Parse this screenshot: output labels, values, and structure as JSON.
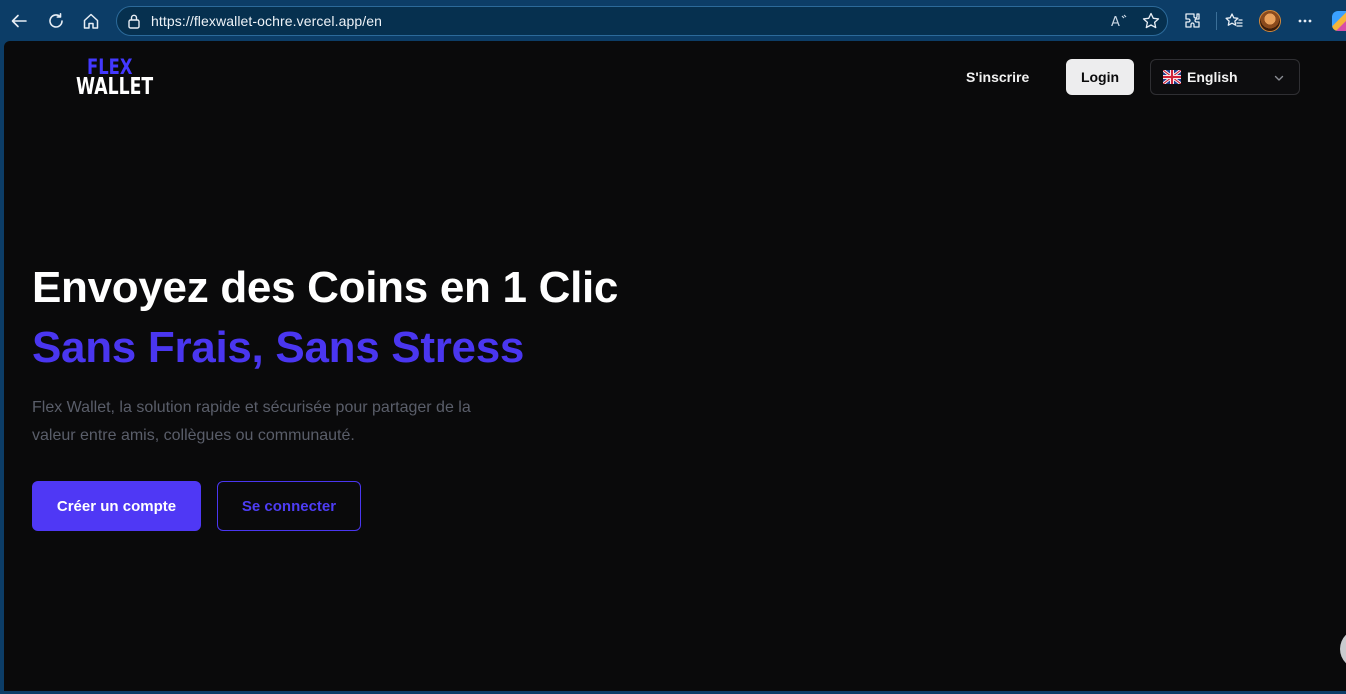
{
  "browser": {
    "url": "https://flexwallet-ochre.vercel.app/en",
    "icons": [
      "back-icon",
      "refresh-icon",
      "home-icon",
      "lock-icon",
      "read-aloud-icon",
      "favorite-star-icon",
      "extensions-icon",
      "favorites-icon",
      "profile-avatar",
      "more-icon",
      "copilot-icon"
    ]
  },
  "logo": {
    "top": "FLEX",
    "bottom": "WALLET"
  },
  "nav": {
    "signup_label": "S'inscrire",
    "login_label": "Login",
    "language": "English"
  },
  "hero": {
    "title": "Envoyez des Coins en 1 Clic",
    "subtitle": "Sans Frais, Sans Stress",
    "description_line1": "Flex Wallet, la solution rapide et sécurisée pour partager de la",
    "description_line2": "valeur entre amis, collègues ou communauté.",
    "primary_button": "Créer un compte",
    "secondary_button": "Se connecter"
  },
  "colors": {
    "accent": "#4f38f5",
    "background": "#0a0a0b",
    "browser_chrome": "#0c3d67"
  }
}
